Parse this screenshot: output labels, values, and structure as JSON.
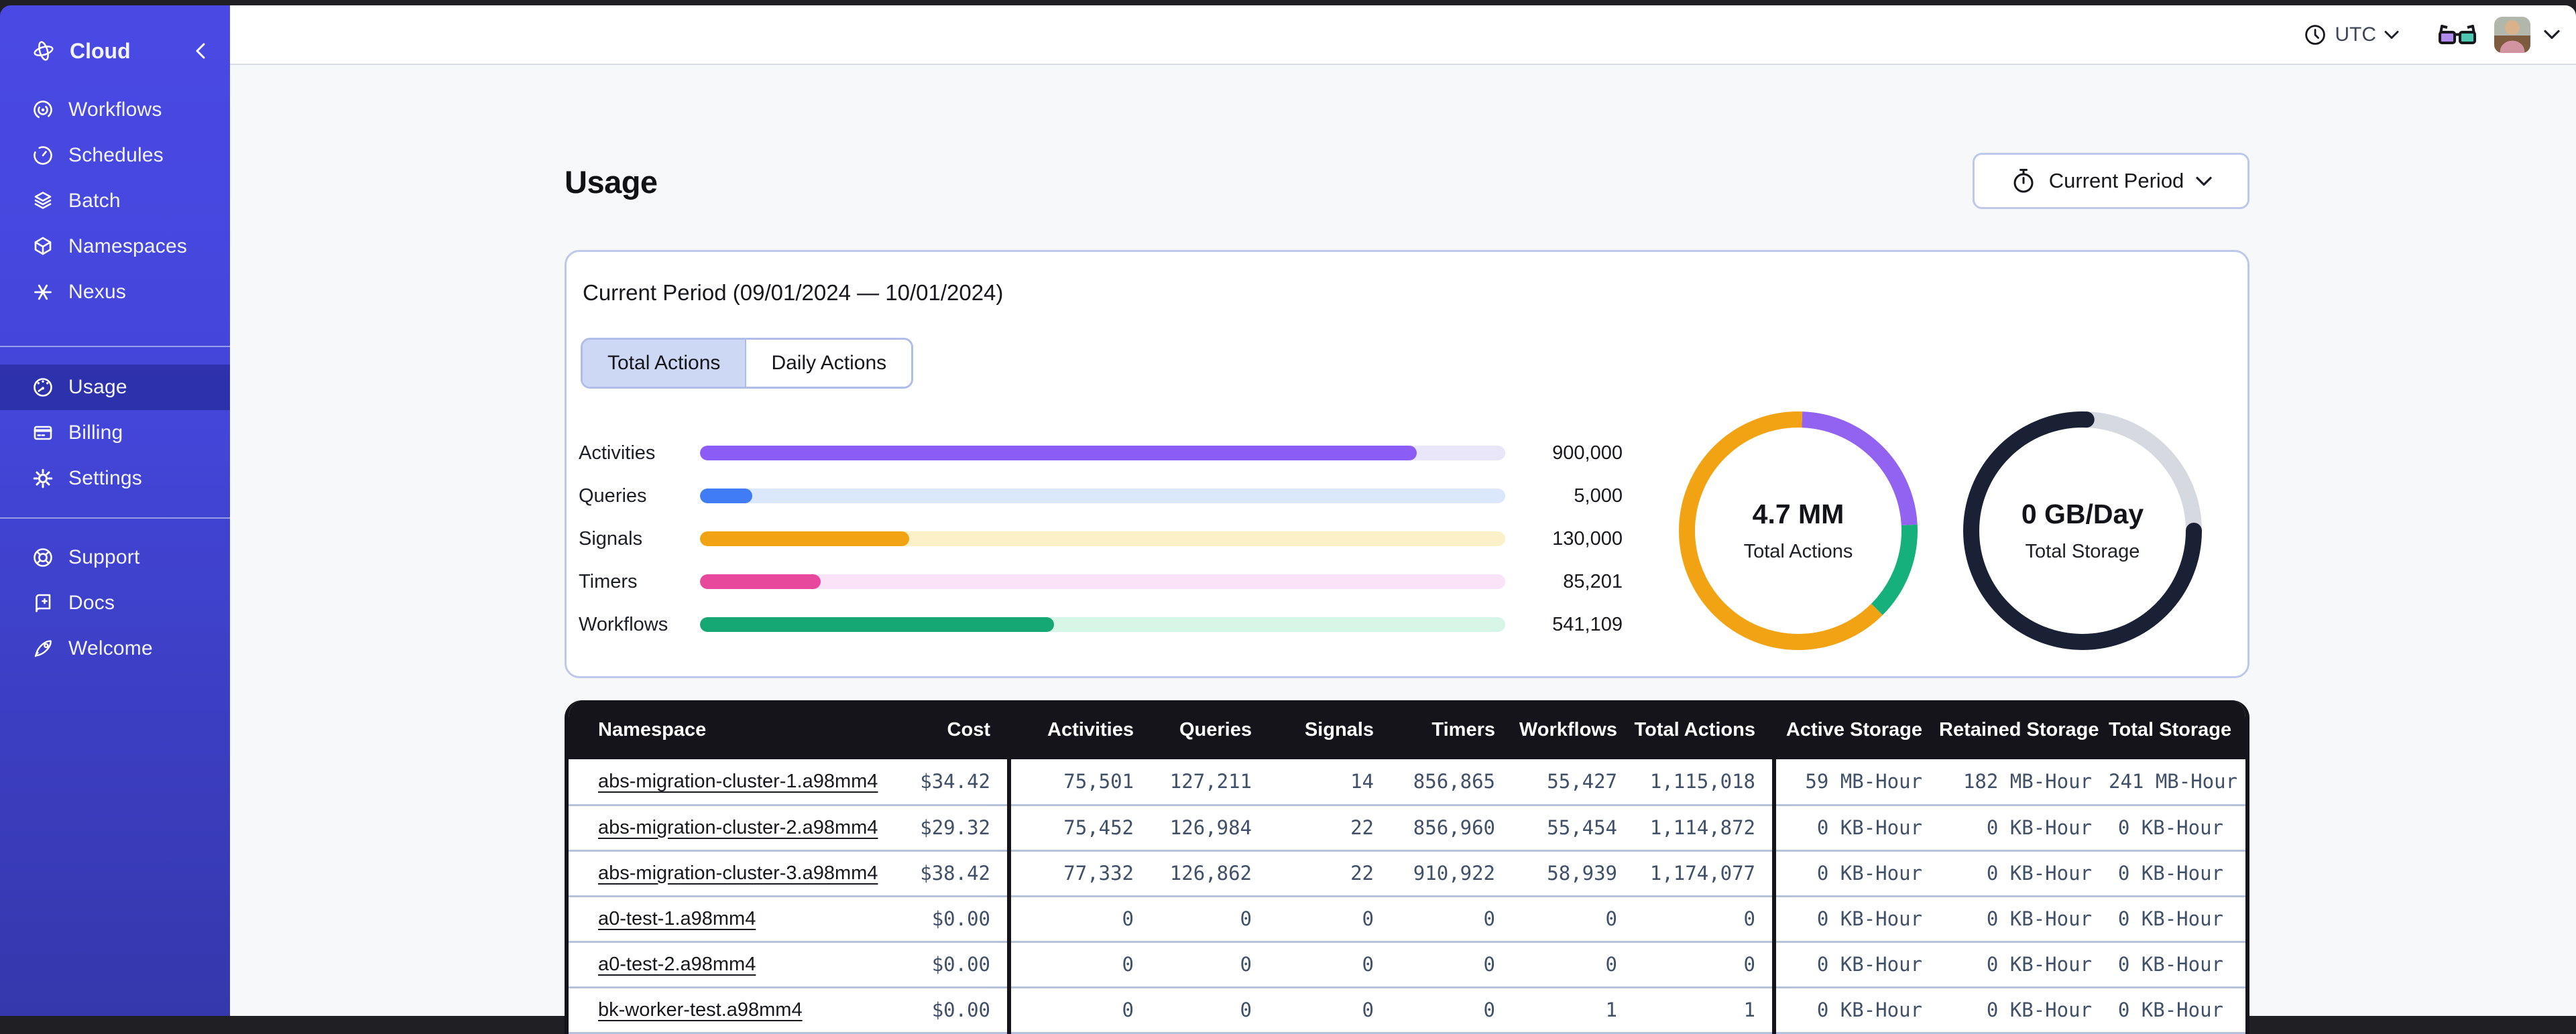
{
  "topbar": {
    "timezone_label": "UTC"
  },
  "sidebar": {
    "brand": "Cloud",
    "groups": [
      {
        "items": [
          {
            "label": "Workflows"
          },
          {
            "label": "Schedules"
          },
          {
            "label": "Batch"
          },
          {
            "label": "Namespaces"
          },
          {
            "label": "Nexus"
          }
        ]
      },
      {
        "items": [
          {
            "label": "Usage",
            "active": true
          },
          {
            "label": "Billing"
          },
          {
            "label": "Settings"
          }
        ]
      },
      {
        "items": [
          {
            "label": "Support"
          },
          {
            "label": "Docs"
          },
          {
            "label": "Welcome"
          }
        ]
      }
    ]
  },
  "page": {
    "title": "Usage",
    "period_selector_label": "Current Period"
  },
  "usage_card": {
    "title": "Current Period (09/01/2024 — 10/01/2024)",
    "tabs": [
      {
        "label": "Total Actions",
        "active": true
      },
      {
        "label": "Daily Actions",
        "active": false
      }
    ]
  },
  "chart_data": {
    "type": "bar",
    "title": "Current Period usage",
    "bars": {
      "categories": [
        "Activities",
        "Queries",
        "Signals",
        "Timers",
        "Workflows"
      ],
      "values": [
        900000,
        5000,
        130000,
        85201,
        541109
      ],
      "display_values": [
        "900,000",
        "5,000",
        "130,000",
        "85,201",
        "541,109"
      ],
      "fill_pct": [
        89,
        6.5,
        26,
        15,
        44
      ],
      "colors": [
        "#8b5cf6",
        "#3f7cf6",
        "#f2a313",
        "#e8489c",
        "#15a875"
      ],
      "track_colors": [
        "#eae6fa",
        "#dbe7fb",
        "#fcf0c8",
        "#fae3f7",
        "#d8f6e8"
      ]
    },
    "donuts": [
      {
        "label": "4.7 MM",
        "sublabel": "Total Actions",
        "cap": "butt",
        "segments": [
          {
            "name": "activities",
            "color": "#9263f0",
            "start_deg": 2,
            "sweep_deg": 85
          },
          {
            "name": "workflows",
            "color": "#16b07c",
            "start_deg": 87,
            "sweep_deg": 48
          },
          {
            "name": "signals",
            "color": "#f2a313",
            "start_deg": 135,
            "sweep_deg": 227
          }
        ]
      },
      {
        "label": "0 GB/Day",
        "sublabel": "Total Storage",
        "cap": "round",
        "segments": [
          {
            "name": "remaining",
            "color": "#d6d9e0",
            "start_deg": 0,
            "sweep_deg": 92
          },
          {
            "name": "storage",
            "color": "#1b2134",
            "start_deg": 90,
            "sweep_deg": 272
          }
        ]
      }
    ]
  },
  "table": {
    "columns": [
      "Namespace",
      "Cost",
      "Activities",
      "Queries",
      "Signals",
      "Timers",
      "Workflows",
      "Total Actions",
      "Active Storage",
      "Retained Storage",
      "Total Storage"
    ],
    "rows": [
      {
        "namespace": "abs-migration-cluster-1.a98mm4",
        "cost": "$34.42",
        "activities": "75,501",
        "queries": "127,211",
        "signals": "14",
        "timers": "856,865",
        "workflows": "55,427",
        "total_actions": "1,115,018",
        "active_storage": "59 MB-Hour",
        "retained_storage": "182 MB-Hour",
        "total_storage": "241 MB-Hour"
      },
      {
        "namespace": "abs-migration-cluster-2.a98mm4",
        "cost": "$29.32",
        "activities": "75,452",
        "queries": "126,984",
        "signals": "22",
        "timers": "856,960",
        "workflows": "55,454",
        "total_actions": "1,114,872",
        "active_storage": "0 KB-Hour",
        "retained_storage": "0 KB-Hour",
        "total_storage": "0 KB-Hour"
      },
      {
        "namespace": "abs-migration-cluster-3.a98mm4",
        "cost": "$38.42",
        "activities": "77,332",
        "queries": "126,862",
        "signals": "22",
        "timers": "910,922",
        "workflows": "58,939",
        "total_actions": "1,174,077",
        "active_storage": "0 KB-Hour",
        "retained_storage": "0 KB-Hour",
        "total_storage": "0 KB-Hour"
      },
      {
        "namespace": "a0-test-1.a98mm4",
        "cost": "$0.00",
        "activities": "0",
        "queries": "0",
        "signals": "0",
        "timers": "0",
        "workflows": "0",
        "total_actions": "0",
        "active_storage": "0 KB-Hour",
        "retained_storage": "0 KB-Hour",
        "total_storage": "0 KB-Hour"
      },
      {
        "namespace": "a0-test-2.a98mm4",
        "cost": "$0.00",
        "activities": "0",
        "queries": "0",
        "signals": "0",
        "timers": "0",
        "workflows": "0",
        "total_actions": "0",
        "active_storage": "0 KB-Hour",
        "retained_storage": "0 KB-Hour",
        "total_storage": "0 KB-Hour"
      },
      {
        "namespace": "bk-worker-test.a98mm4",
        "cost": "$0.00",
        "activities": "0",
        "queries": "0",
        "signals": "0",
        "timers": "0",
        "workflows": "1",
        "total_actions": "1",
        "active_storage": "0 KB-Hour",
        "retained_storage": "0 KB-Hour",
        "total_storage": "0 KB-Hour"
      }
    ]
  }
}
